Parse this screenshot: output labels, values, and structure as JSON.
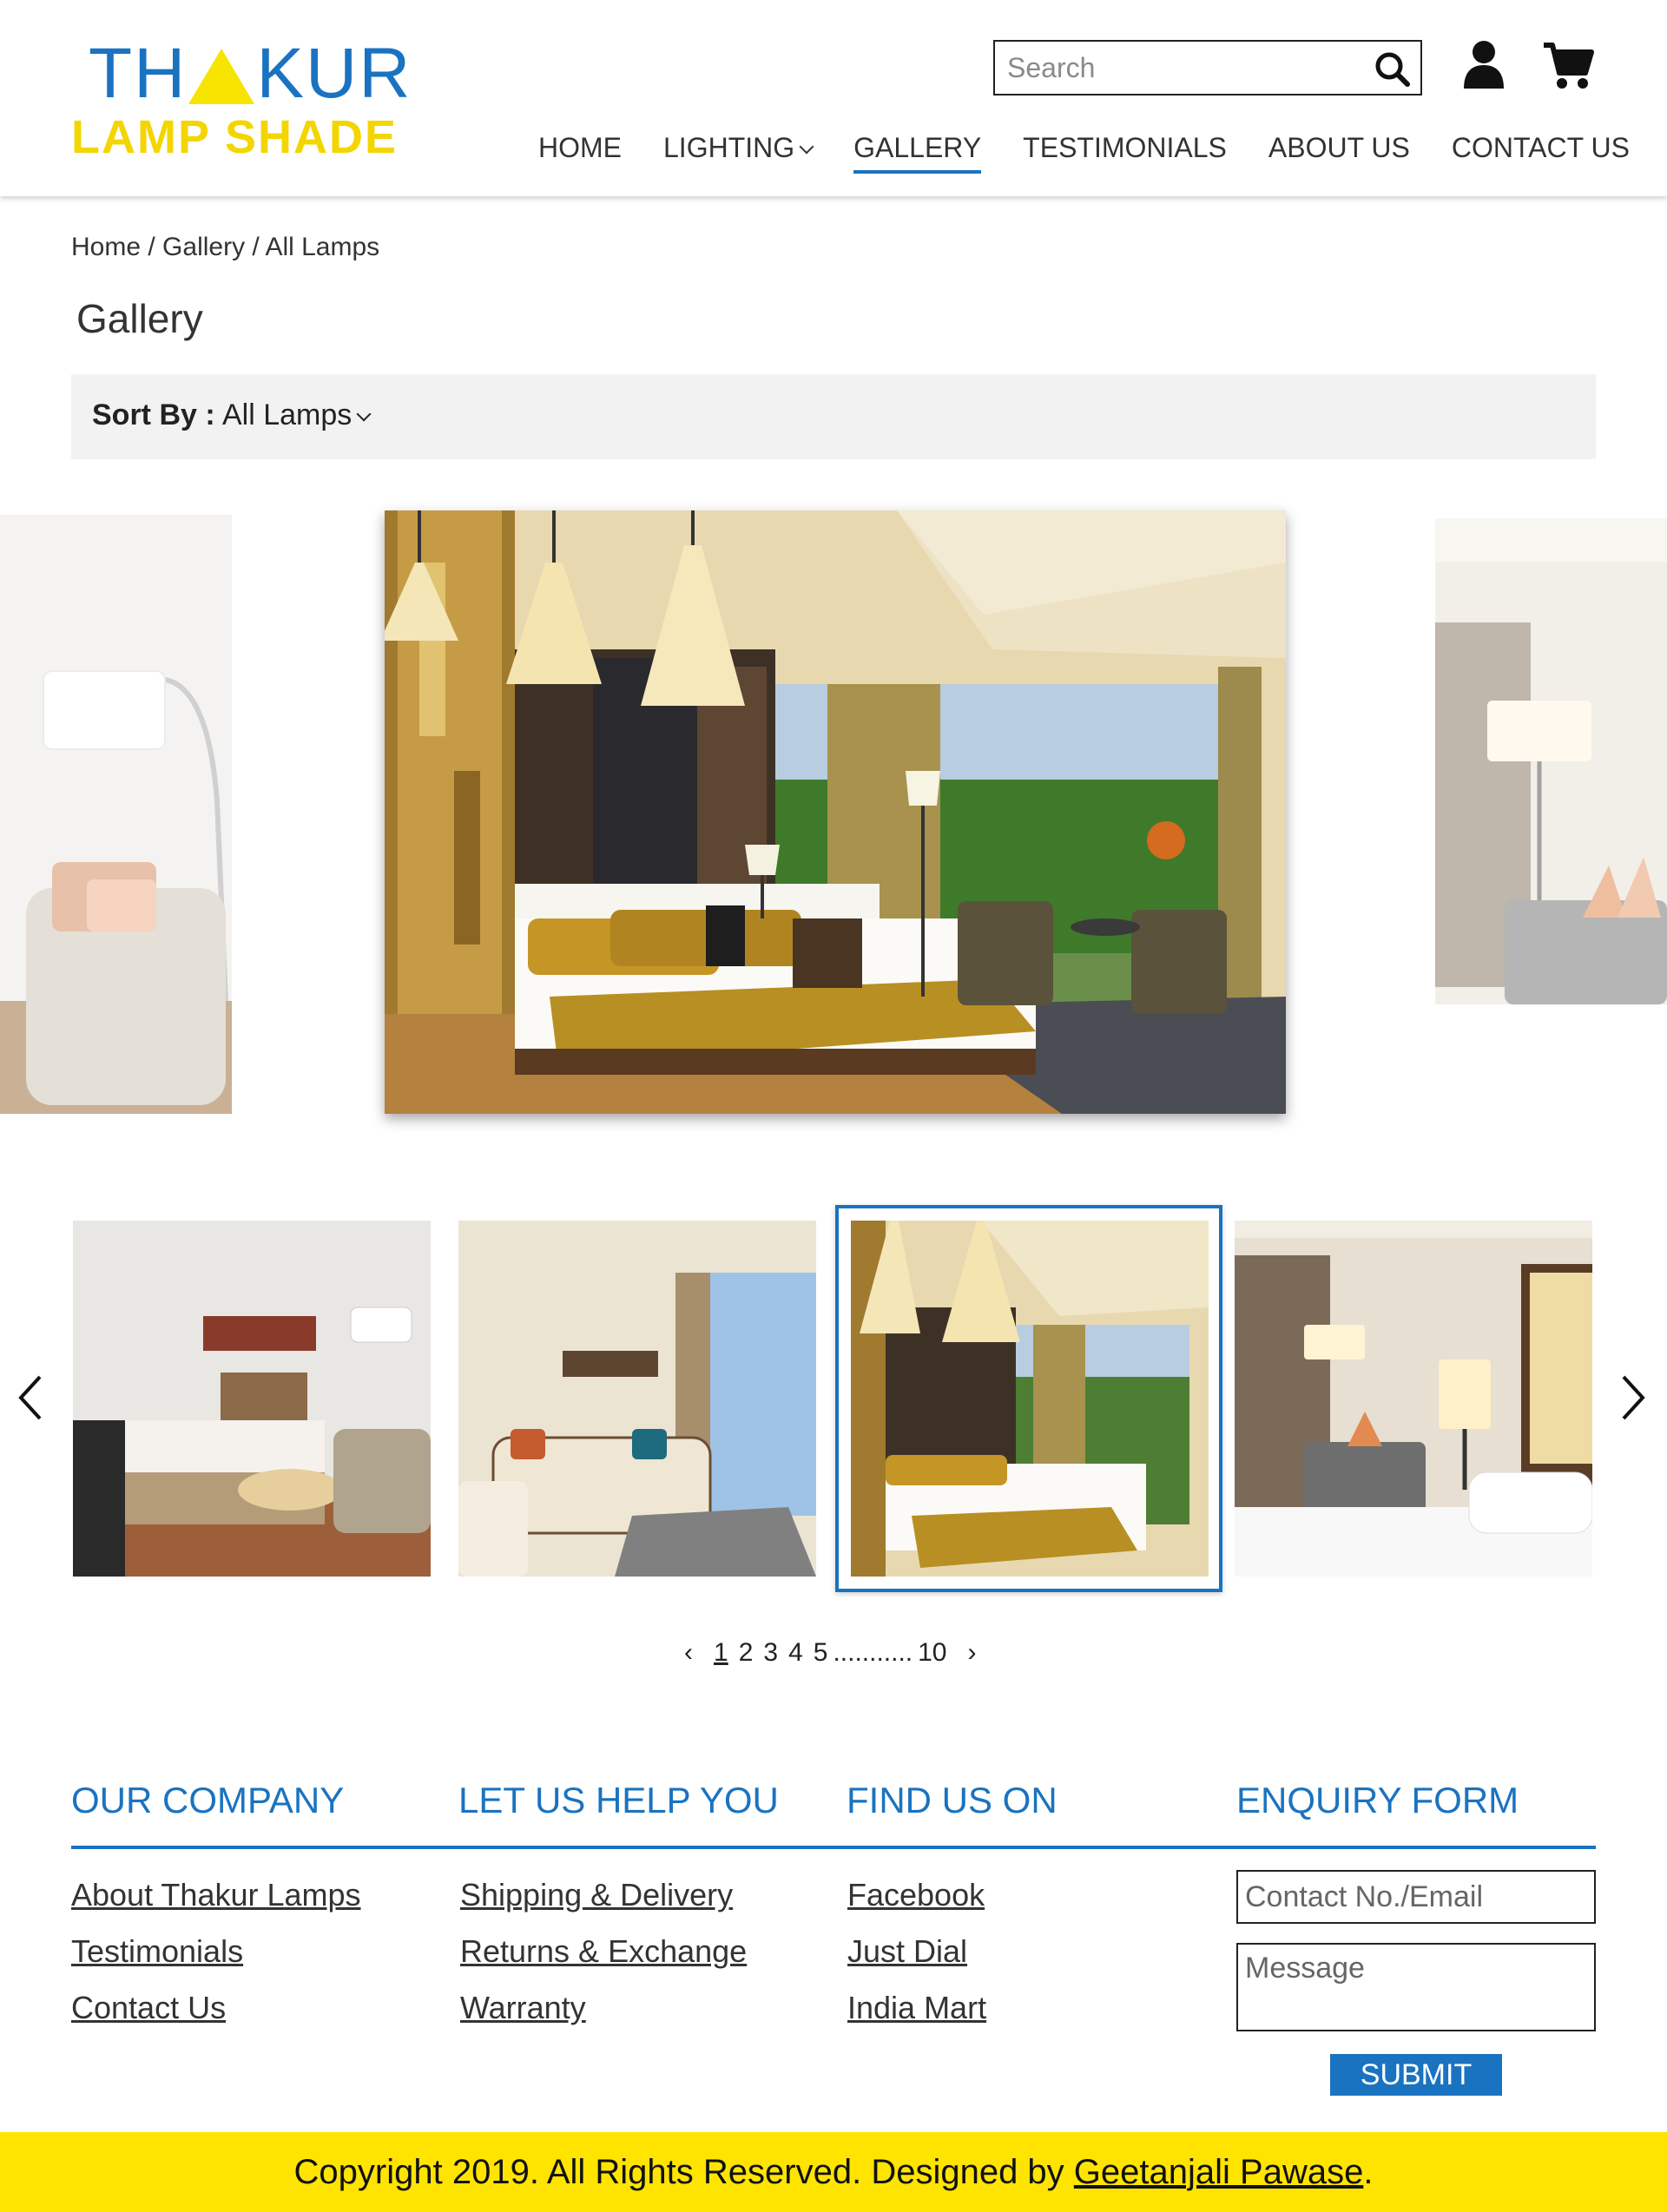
{
  "brand": {
    "line1_a": "TH",
    "line1_b": "KUR",
    "line2": "LAMP SHADE",
    "primary_color": "#1a73c0",
    "accent_color": "#f3d500"
  },
  "header": {
    "search_placeholder": "Search",
    "icons": [
      "search-icon",
      "user-icon",
      "cart-icon"
    ],
    "nav": [
      {
        "label": "HOME"
      },
      {
        "label": "LIGHTING",
        "has_dropdown": true
      },
      {
        "label": "GALLERY",
        "active": true
      },
      {
        "label": "TESTIMONIALS"
      },
      {
        "label": "ABOUT US"
      },
      {
        "label": "CONTACT US"
      }
    ]
  },
  "breadcrumb": {
    "home": "Home",
    "gallery": "Gallery",
    "current": "All Lamps",
    "sep": " / "
  },
  "page_title": "Gallery",
  "sort": {
    "label": "Sort By :",
    "value": "All Lamps"
  },
  "carousel": {
    "main_scene": "bedroom-pendant-lamps",
    "thumbnails": [
      "bedroom-floor-lamp",
      "living-room",
      "bedroom-pendant-lamps",
      "hotel-bedroom-table-lamp"
    ],
    "selected_thumbnail": 3
  },
  "pagination": {
    "pages": [
      "1",
      "2",
      "3",
      "4",
      "5"
    ],
    "ellipsis": "...........",
    "last": "10",
    "current": "1"
  },
  "footer": {
    "columns": [
      {
        "heading": "OUR COMPANY",
        "links": [
          "About Thakur Lamps",
          "Testimonials",
          "Contact Us"
        ]
      },
      {
        "heading": "LET US HELP YOU",
        "links": [
          "Shipping & Delivery",
          "Returns & Exchange",
          "Warranty"
        ]
      },
      {
        "heading": "FIND US ON",
        "links": [
          "Facebook",
          "Just Dial",
          "India Mart"
        ]
      },
      {
        "heading": "ENQUIRY FORM"
      }
    ],
    "enquiry": {
      "contact_placeholder": "Contact No./Email",
      "message_placeholder": "Message",
      "submit": "SUBMIT"
    },
    "copyright_text": "Copyright 2019. All Rights Reserved. Designed by ",
    "designer": "Geetanjali Pawase",
    "copyright_end": "."
  }
}
